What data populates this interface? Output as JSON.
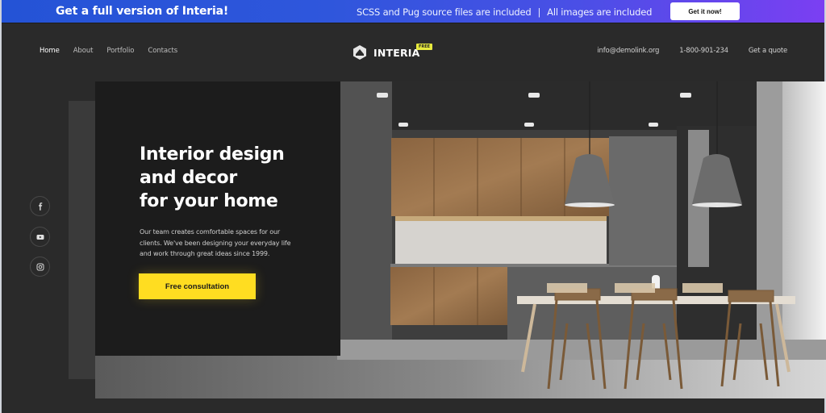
{
  "promo": {
    "title": "Get a full version of Interia!",
    "info_left": "SCSS and Pug source files are included",
    "separator": "|",
    "info_right": "All images are included",
    "button_label": "Get it now!"
  },
  "header": {
    "nav": [
      {
        "label": "Home",
        "active": true
      },
      {
        "label": "About",
        "active": false
      },
      {
        "label": "Portfolio",
        "active": false
      },
      {
        "label": "Contacts",
        "active": false
      }
    ],
    "logo": {
      "text": "INTERIA",
      "badge": "FREE",
      "icon": "interia-logo-icon"
    },
    "contacts": {
      "email": "info@demolink.org",
      "phone": "1-800-901-234",
      "quote_label": "Get a quote"
    }
  },
  "hero": {
    "title_lines": [
      "Interior design",
      "and decor",
      "for your home"
    ],
    "description": "Our team creates comfortable spaces for our clients. We've been designing your everyday life and work through great ideas since 1999.",
    "cta_label": "Free consultation",
    "image_alt": "modern kitchen interior with dining table and pendant lamps"
  },
  "social": [
    {
      "name": "facebook-icon"
    },
    {
      "name": "youtube-icon"
    },
    {
      "name": "instagram-icon"
    }
  ],
  "colors": {
    "accent": "#ffdd21",
    "background": "#2a2a2a",
    "panel": "#1c1c1c",
    "banner_start": "#2453d6",
    "banner_end": "#7b3ff2"
  }
}
